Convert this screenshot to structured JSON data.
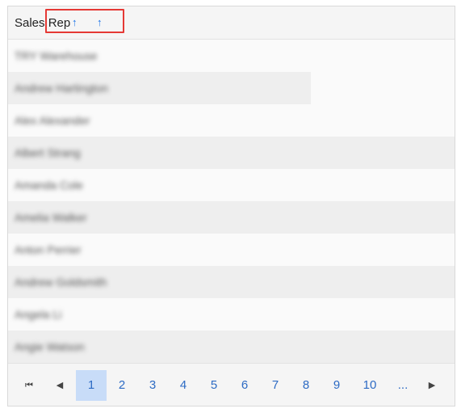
{
  "header": {
    "title": "Sales Rep",
    "sort_icon": "↑",
    "sort_icon_secondary": "↑"
  },
  "rows": [
    "TRY Warehouse",
    "Andrew Hartington",
    "Alex Alexander",
    "Albert Strang",
    "Amanda Cole",
    "Amelia Walker",
    "Anton Perrier",
    "Andrew Goldsmith",
    "Angela Li",
    "Angie Watson"
  ],
  "pager": {
    "first": "⏮",
    "prev": "◀",
    "pages": [
      "1",
      "2",
      "3",
      "4",
      "5",
      "6",
      "7",
      "8",
      "9",
      "10",
      "..."
    ],
    "next": "▶",
    "active_page": "1"
  }
}
